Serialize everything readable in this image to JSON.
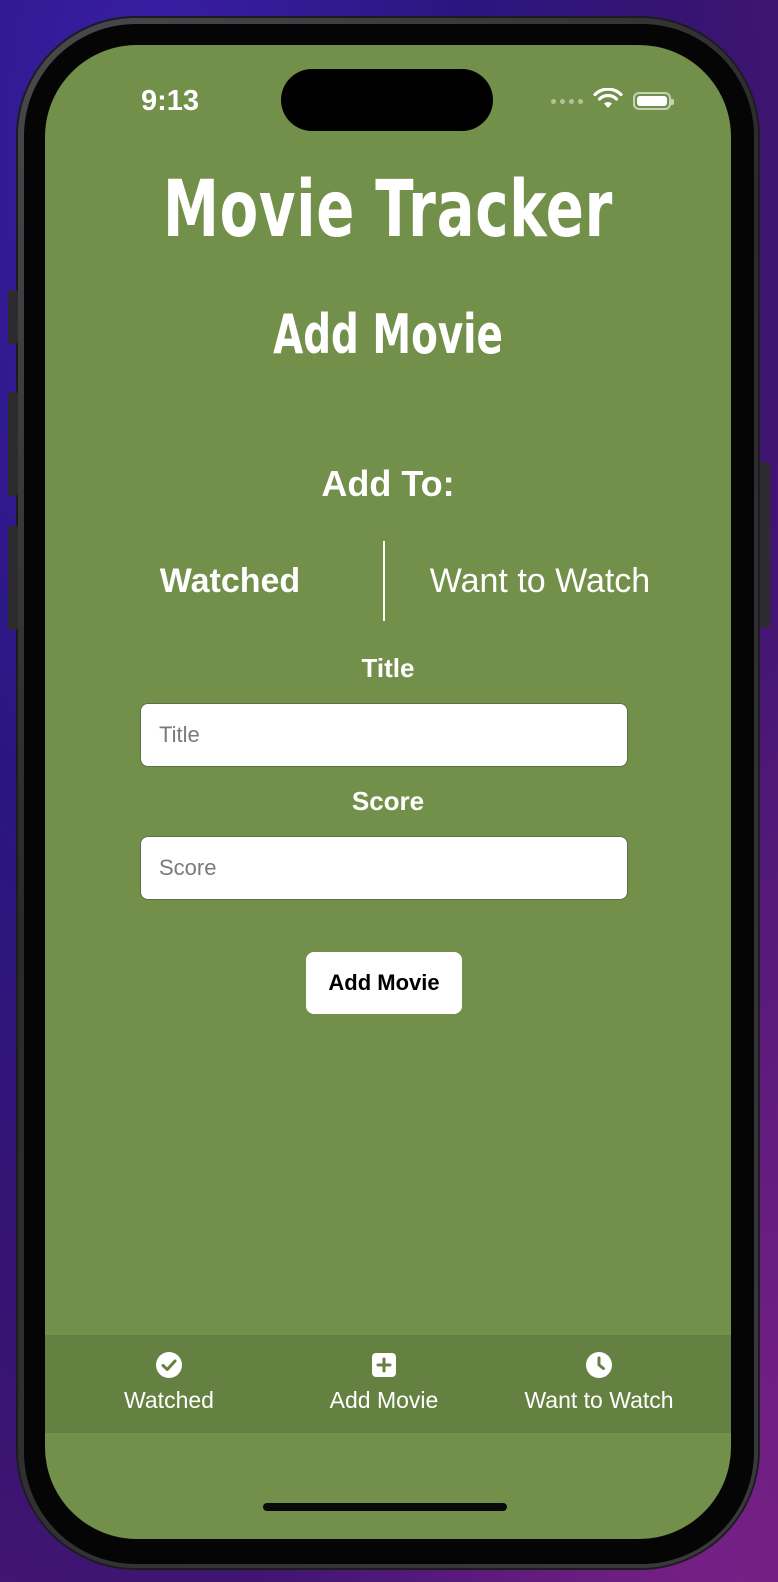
{
  "status_bar": {
    "time": "9:13"
  },
  "app": {
    "title": "Movie Tracker",
    "page_title": "Add Movie"
  },
  "form": {
    "add_to_label": "Add To:",
    "segments": [
      {
        "label": "Watched",
        "selected": true
      },
      {
        "label": "Want to Watch",
        "selected": false
      }
    ],
    "title_label": "Title",
    "title_value": "",
    "title_placeholder": "Title",
    "score_label": "Score",
    "score_value": "",
    "score_placeholder": "Score",
    "submit_label": "Add Movie"
  },
  "tab_bar": {
    "items": [
      {
        "label": "Watched",
        "icon": "checkmark-circle-icon"
      },
      {
        "label": "Add Movie",
        "icon": "plus-square-icon"
      },
      {
        "label": "Want to Watch",
        "icon": "clock-icon"
      }
    ]
  },
  "colors": {
    "screen_background": "#72904a",
    "tab_bar_background": "#658141",
    "text": "#ffffff"
  }
}
